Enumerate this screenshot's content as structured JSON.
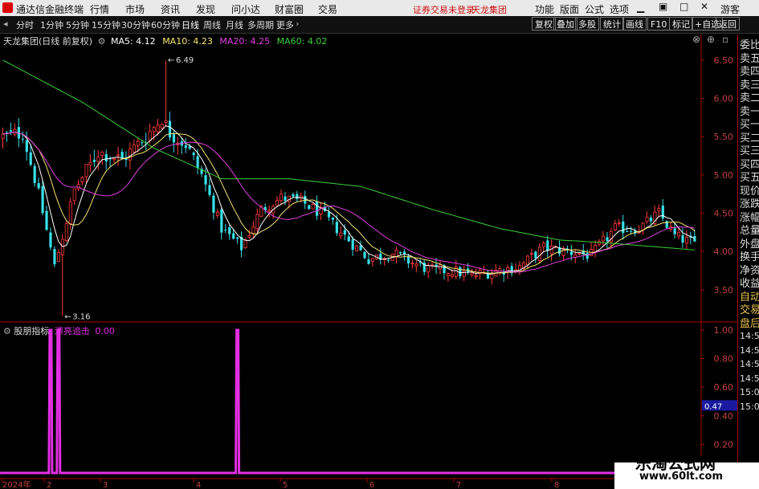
{
  "menubar": {
    "app_title": "通达信金融终端",
    "menus": [
      "行情",
      "市场",
      "资讯",
      "发现",
      "问小达",
      "财富圈",
      "交易"
    ],
    "notice": "证券交易未登录",
    "stock_name": "天龙集团",
    "right_menus": [
      "功能",
      "版面",
      "公式",
      "选项"
    ],
    "guest": "游客"
  },
  "toolbar": {
    "periods": [
      "分时",
      "1分钟",
      "5分钟",
      "15分钟",
      "30分钟",
      "60分钟",
      "日线",
      "周线",
      "月线",
      "多周期",
      "更多"
    ],
    "active_period": "日线",
    "right_buttons": [
      "复权",
      "叠加",
      "多股",
      "统计",
      "画线",
      "F10",
      "标记",
      "+自选",
      "返回"
    ]
  },
  "main_chart": {
    "title": "天龙集团(日线 前复权)",
    "ma_labels": [
      {
        "label": "MA5: 4.12",
        "color": "#ffffff"
      },
      {
        "label": "MA10: 4.23",
        "color": "#f2e66e"
      },
      {
        "label": "MA20: 4.25",
        "color": "#e040e0"
      },
      {
        "label": "MA60: 4.02",
        "color": "#3ccf3c"
      }
    ],
    "high_label": "6.49",
    "low_label": "3.16",
    "y_ticks": [
      "6.50",
      "6.00",
      "5.50",
      "5.00",
      "4.50",
      "4.00",
      "3.50"
    ]
  },
  "sub_chart": {
    "name": "股朋指标",
    "series_label": "漂亮追击",
    "value": "0.00",
    "y_ticks": [
      "1.00",
      "0.80",
      "0.60",
      "0.40",
      "0.20"
    ],
    "cursor_value": "0.47"
  },
  "x_axis": {
    "labels": [
      "2024年",
      "2",
      "3",
      "4",
      "5",
      "6",
      "7",
      "8"
    ]
  },
  "right_panel": {
    "items": [
      "委比",
      "卖五",
      "卖四",
      "卖三",
      "卖二",
      "卖一",
      "买一",
      "买二",
      "买三",
      "买四",
      "买五",
      "现价",
      "涨跌",
      "涨幅",
      "总量",
      "外盘",
      "换手",
      "净资",
      "收益",
      "自动",
      "交易",
      "盘后"
    ],
    "times": [
      "14:5",
      "14:5",
      "14:5",
      "14:5",
      "15:0",
      "15:0"
    ]
  },
  "watermark": {
    "cn": "乐淘公式网",
    "url": "www.60lt.com"
  },
  "colors": {
    "up": "#ff3b3b",
    "down": "#38e0e8",
    "ma5": "#ffffff",
    "ma10": "#f2e66e",
    "ma20": "#e040e0",
    "ma60": "#3ccf3c",
    "signal": "#e32ee3",
    "axis": "#aa0000"
  },
  "chart_data": {
    "type": "candlestick",
    "ylim": [
      3.1,
      6.75
    ],
    "anchors": [
      {
        "i": 0,
        "p": 5.5
      },
      {
        "i": 5,
        "p": 5.55
      },
      {
        "i": 9,
        "p": 4.75
      },
      {
        "i": 13,
        "p": 3.8
      },
      {
        "i": 18,
        "p": 4.8
      },
      {
        "i": 24,
        "p": 5.3
      },
      {
        "i": 30,
        "p": 5.2
      },
      {
        "i": 36,
        "p": 5.5
      },
      {
        "i": 40,
        "p": 5.75
      },
      {
        "i": 42,
        "p": 5.55
      },
      {
        "i": 46,
        "p": 5.4
      },
      {
        "i": 50,
        "p": 5.0
      },
      {
        "i": 55,
        "p": 4.3
      },
      {
        "i": 60,
        "p": 4.05
      },
      {
        "i": 65,
        "p": 4.55
      },
      {
        "i": 70,
        "p": 4.7
      },
      {
        "i": 75,
        "p": 4.65
      },
      {
        "i": 80,
        "p": 4.5
      },
      {
        "i": 86,
        "p": 4.2
      },
      {
        "i": 92,
        "p": 3.9
      },
      {
        "i": 98,
        "p": 3.98
      },
      {
        "i": 103,
        "p": 3.85
      },
      {
        "i": 108,
        "p": 3.75
      },
      {
        "i": 113,
        "p": 3.75
      },
      {
        "i": 118,
        "p": 3.68
      },
      {
        "i": 124,
        "p": 3.75
      },
      {
        "i": 130,
        "p": 3.8
      },
      {
        "i": 136,
        "p": 4.05
      },
      {
        "i": 142,
        "p": 4.0
      },
      {
        "i": 148,
        "p": 3.95
      },
      {
        "i": 154,
        "p": 4.3
      },
      {
        "i": 160,
        "p": 4.3
      },
      {
        "i": 165,
        "p": 4.5
      },
      {
        "i": 169,
        "p": 4.2
      },
      {
        "i": 174,
        "p": 4.1
      }
    ],
    "ma60_points": [
      {
        "i": 0,
        "p": 6.5
      },
      {
        "i": 20,
        "p": 5.95
      },
      {
        "i": 38,
        "p": 5.35
      },
      {
        "i": 55,
        "p": 4.95
      },
      {
        "i": 72,
        "p": 4.95
      },
      {
        "i": 90,
        "p": 4.85
      },
      {
        "i": 108,
        "p": 4.55
      },
      {
        "i": 125,
        "p": 4.3
      },
      {
        "i": 140,
        "p": 4.15
      },
      {
        "i": 150,
        "p": 4.12
      },
      {
        "i": 174,
        "p": 4.02
      }
    ],
    "extremes": [
      {
        "i": 15,
        "p": 3.16,
        "type": "low"
      },
      {
        "i": 41,
        "p": 6.49,
        "type": "high"
      }
    ],
    "signal_spikes": [
      12,
      14,
      59
    ],
    "signal_ylim": [
      0,
      1.0
    ]
  }
}
